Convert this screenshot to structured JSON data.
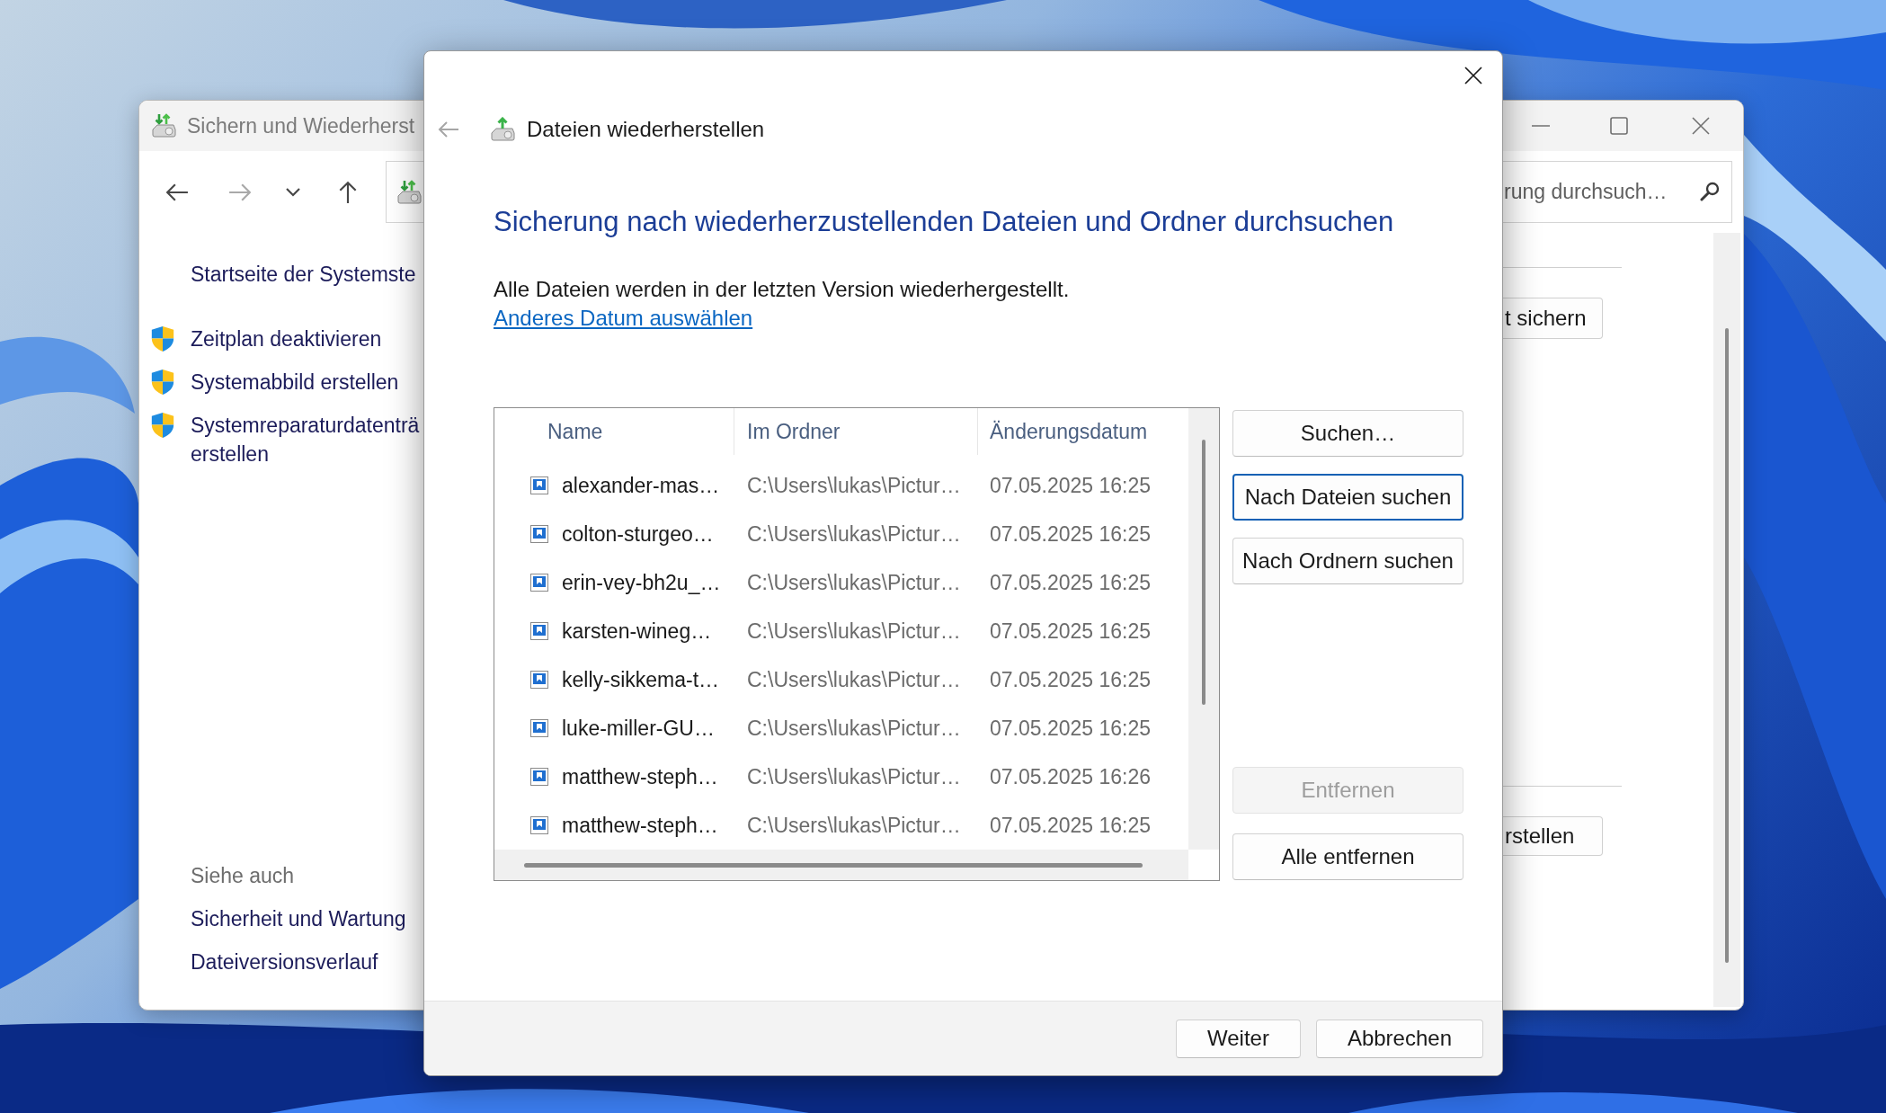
{
  "background_window": {
    "title": "Sichern und Wiederherst",
    "nav_buttons": [
      {
        "kind": "back",
        "disabled": false
      },
      {
        "kind": "forward",
        "disabled": true
      },
      {
        "kind": "recent",
        "disabled": false
      },
      {
        "kind": "up",
        "disabled": false
      }
    ],
    "search": {
      "placeholder": "rung durchsuch…"
    },
    "sidebar": {
      "home_link": "Startseite der Systemste",
      "tasks": [
        "Zeitplan deaktivieren",
        "Systemabbild erstellen",
        "Systemreparaturdatenträ erstellen"
      ],
      "see_also": {
        "heading": "Siehe auch",
        "links": [
          "Sicherheit und Wartung",
          "Dateiversionsverlauf"
        ]
      }
    },
    "content_buttons": [
      "t sichern",
      "rstellen"
    ]
  },
  "dialog": {
    "back_button": {
      "disabled": true
    },
    "title": "Dateien wiederherstellen",
    "heading": "Sicherung nach wiederherzustellenden Dateien und Ordner durchsuchen",
    "description": "Alle Dateien werden in der letzten Version wiederhergestellt.",
    "link": "Anderes Datum auswählen",
    "table": {
      "columns": [
        "Name",
        "Im Ordner",
        "Änderungsdatum"
      ],
      "rows": [
        {
          "name": "alexander-mas…",
          "folder": "C:\\Users\\lukas\\Pictur…",
          "modified": "07.05.2025 16:25"
        },
        {
          "name": "colton-sturgeo…",
          "folder": "C:\\Users\\lukas\\Pictur…",
          "modified": "07.05.2025 16:25"
        },
        {
          "name": "erin-vey-bh2u_…",
          "folder": "C:\\Users\\lukas\\Pictur…",
          "modified": "07.05.2025 16:25"
        },
        {
          "name": "karsten-wineg…",
          "folder": "C:\\Users\\lukas\\Pictur…",
          "modified": "07.05.2025 16:25"
        },
        {
          "name": "kelly-sikkema-t…",
          "folder": "C:\\Users\\lukas\\Pictur…",
          "modified": "07.05.2025 16:25"
        },
        {
          "name": "luke-miller-GU…",
          "folder": "C:\\Users\\lukas\\Pictur…",
          "modified": "07.05.2025 16:25"
        },
        {
          "name": "matthew-steph…",
          "folder": "C:\\Users\\lukas\\Pictur…",
          "modified": "07.05.2025 16:26"
        },
        {
          "name": "matthew-steph…",
          "folder": "C:\\Users\\lukas\\Pictur…",
          "modified": "07.05.2025 16:25"
        }
      ]
    },
    "search_buttons": [
      {
        "label": "Suchen…",
        "focused": false,
        "disabled": false
      },
      {
        "label": "Nach Dateien suchen",
        "focused": true,
        "disabled": false
      },
      {
        "label": "Nach Ordnern suchen",
        "focused": false,
        "disabled": false
      }
    ],
    "remove_buttons": [
      {
        "label": "Entfernen",
        "focused": false,
        "disabled": true
      },
      {
        "label": "Alle entfernen",
        "focused": false,
        "disabled": false
      }
    ],
    "footer_buttons": [
      "Weiter",
      "Abbrechen"
    ]
  }
}
